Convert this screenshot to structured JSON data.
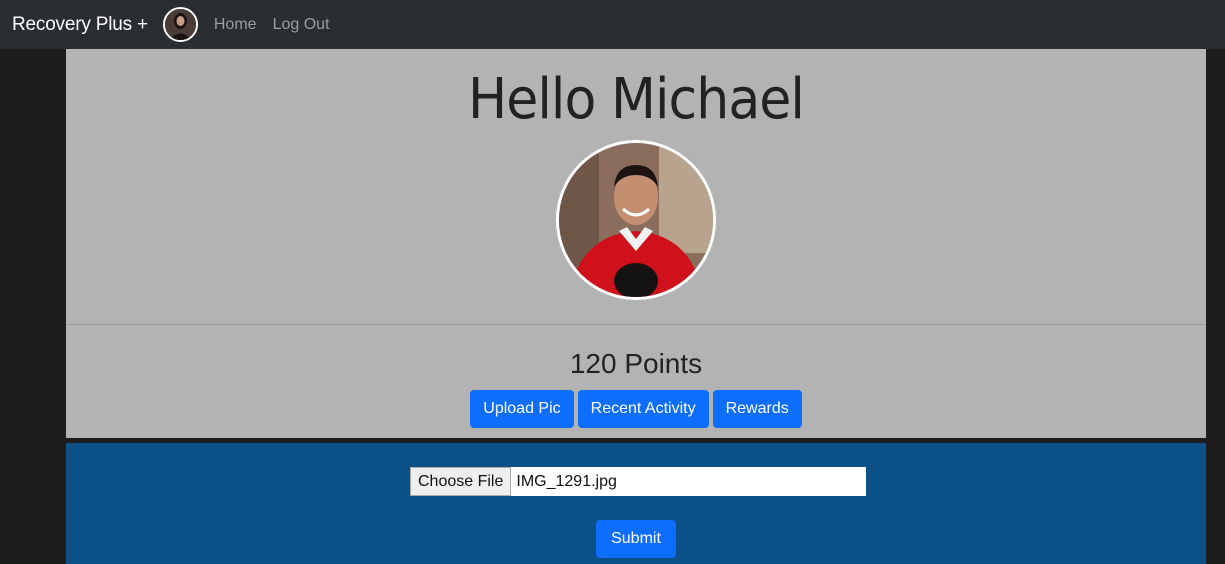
{
  "navbar": {
    "brand": "Recovery Plus +",
    "links": [
      "Home",
      "Log Out"
    ]
  },
  "profile": {
    "greeting": "Hello Michael",
    "points": "120 Points"
  },
  "actions": [
    "Upload Pic",
    "Recent Activity",
    "Rewards"
  ],
  "upload": {
    "choose_label": "Choose File",
    "file_name": "IMG_1291.jpg",
    "submit_label": "Submit"
  },
  "colors": {
    "navbar": "#2a2e32",
    "jumbotron": "#b3b3b3",
    "primary_button": "#0d6efd",
    "upload_panel": "#0b5188"
  }
}
